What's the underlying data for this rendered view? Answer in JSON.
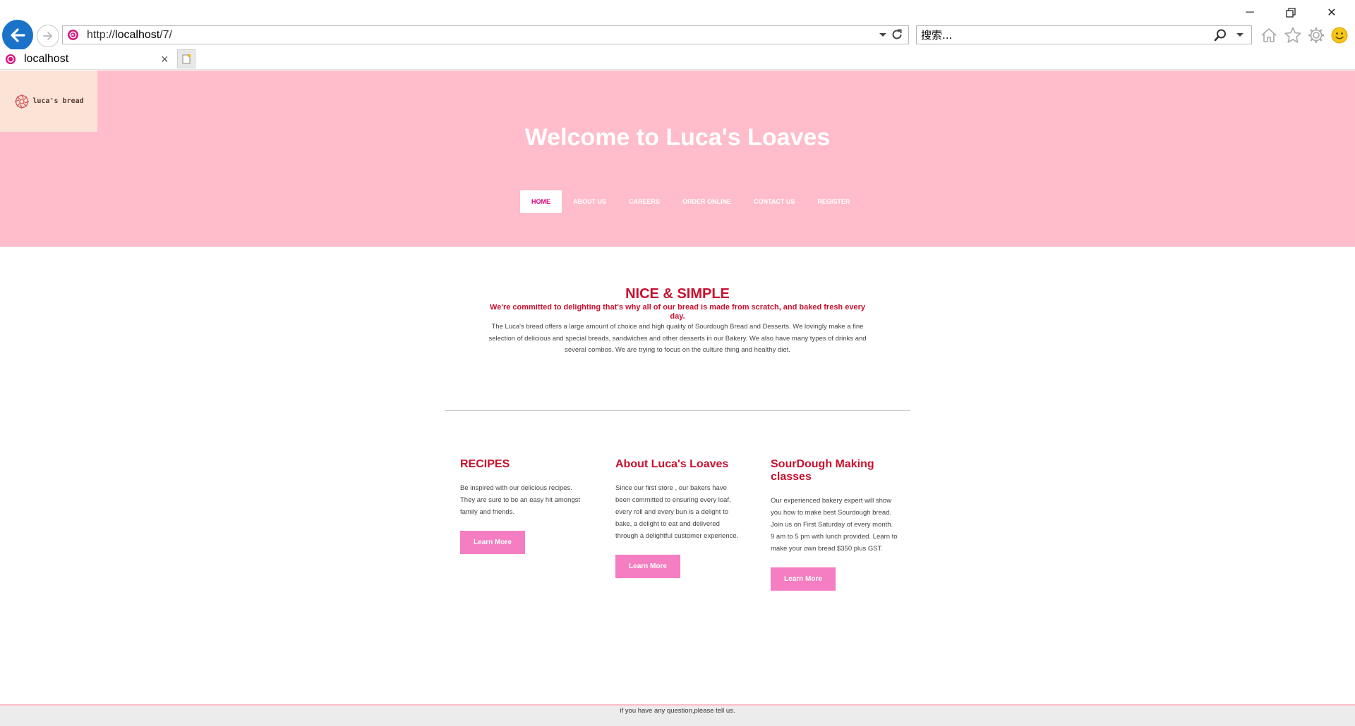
{
  "browser": {
    "url_scheme": "http://",
    "url_host": "localhost",
    "url_path": "/7/",
    "search_placeholder": "搜索...",
    "tab_title": "localhost",
    "tab_close": "×",
    "icons": [
      "back-arrow-icon",
      "forward-arrow-icon",
      "site-favicon",
      "dropdown-icon",
      "refresh-icon",
      "search-icon",
      "home-icon",
      "favorites-star-icon",
      "settings-gear-icon",
      "smiley-feedback-icon",
      "new-tab-icon",
      "minimize-icon",
      "restore-icon",
      "close-icon"
    ],
    "window": {
      "minimize": "─",
      "close": "✕"
    }
  },
  "header": {
    "logo_text": "luca's bread",
    "title": "Welcome to Luca's Loaves",
    "nav": [
      "HOME",
      "ABOUT US",
      "CAREERS",
      "ORDER ONLINE",
      "CONTACT US",
      "REGISTER"
    ],
    "active_nav": "HOME"
  },
  "intro": {
    "title": "NICE & SIMPLE",
    "subtitle": "We're committed to delighting that's why all of our bread is made from scratch, and baked fresh every day.",
    "body": "The Luca's bread offers a large amount of choice and high quality of Sourdough Bread and Desserts. We lovingly make a fine selection of delicious and special breads, sandwiches and other desserts in our Bakery. We also have many types of drinks and several combos. We are trying to focus on the culture thing and healthy diet."
  },
  "columns": [
    {
      "title": "RECIPES",
      "text": "Be inspired with our delicious recipes. They are sure to be an easy hit amongst family and friends.",
      "button": "Learn More"
    },
    {
      "title": "About Luca's Loaves",
      "text": "Since our first store , our bakers have been committed to ensuring every loaf, every roll and every bun is a delight to bake, a delight to eat and delivered through a delightful customer experience.",
      "button": "Learn More"
    },
    {
      "title": "SourDough Making classes",
      "text": "Our experienced bakery expert will show you how to make best Sourdough bread. Join us on First Saturday of every month. 9 am to 5 pm with lunch provided. Learn to make your own bread $350 plus GST.",
      "button": "Learn More"
    }
  ],
  "footer": {
    "text": "if you have any question,please tell us."
  },
  "colors": {
    "hero_bg": "#ffbccb",
    "accent_red": "#c8102e",
    "button_pink": "#f57dc1",
    "logo_bg": "#fbe3d6",
    "nav_active_text": "#e0007a"
  }
}
